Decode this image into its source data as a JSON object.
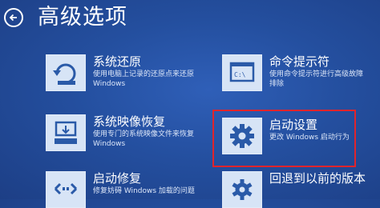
{
  "header": {
    "title": "高级选项"
  },
  "options": [
    {
      "label": "系统还原",
      "desc1": "使用电脑上记录的还原点来还原",
      "desc2": "Windows",
      "icon": "system-restore-icon"
    },
    {
      "label": "系统映像恢复",
      "desc1": "使用专门的系统映像文件来恢复",
      "desc2": "Windows",
      "icon": "system-image-icon"
    },
    {
      "label": "启动修复",
      "desc1": "修复妨碍 Windows 加载的问题",
      "desc2": "",
      "icon": "startup-repair-icon"
    },
    {
      "label": "命令提示符",
      "desc1": "使用命令提示符进行高级故障",
      "desc2": "排除",
      "icon": "command-prompt-icon"
    },
    {
      "label": "启动设置",
      "desc1": "更改 Windows 启动行为",
      "desc2": "",
      "icon": "gear-icon"
    },
    {
      "label": "回退到以前的版本",
      "desc1": "",
      "desc2": "",
      "icon": "go-back-icon"
    }
  ],
  "highlight_color": "#e0242c"
}
